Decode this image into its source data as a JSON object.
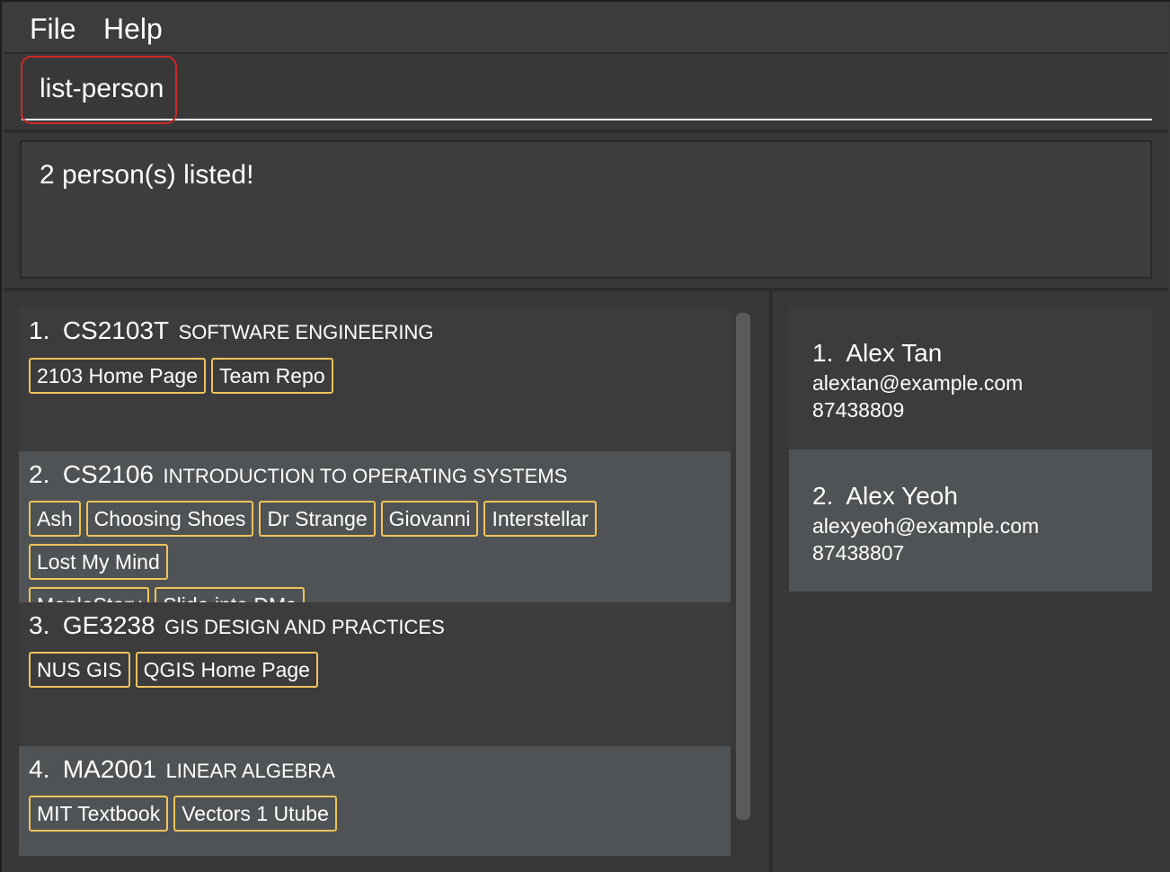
{
  "menu": {
    "file_label": "File",
    "help_label": "Help"
  },
  "command": {
    "value": "list-person"
  },
  "result": {
    "message": "2 person(s) listed!"
  },
  "modules": [
    {
      "index": "1.",
      "code": "CS2103T",
      "title": "SOFTWARE ENGINEERING",
      "tags": [
        "2103 Home Page",
        "Team Repo"
      ]
    },
    {
      "index": "2.",
      "code": "CS2106",
      "title": "INTRODUCTION TO OPERATING SYSTEMS",
      "tags": [
        "Ash",
        "Choosing Shoes",
        "Dr Strange",
        "Giovanni",
        "Interstellar",
        "Lost My Mind",
        "MapleStory",
        "Slide into DMs"
      ]
    },
    {
      "index": "3.",
      "code": "GE3238",
      "title": "GIS DESIGN AND PRACTICES",
      "tags": [
        "NUS GIS",
        "QGIS Home Page"
      ]
    },
    {
      "index": "4.",
      "code": "MA2001",
      "title": "LINEAR ALGEBRA",
      "tags": [
        "MIT Textbook",
        "Vectors 1 Utube"
      ]
    }
  ],
  "persons": [
    {
      "index": "1.",
      "name": "Alex Tan",
      "email": "alextan@example.com",
      "phone": "87438809"
    },
    {
      "index": "2.",
      "name": "Alex Yeoh",
      "email": "alexyeoh@example.com",
      "phone": "87438807"
    }
  ]
}
